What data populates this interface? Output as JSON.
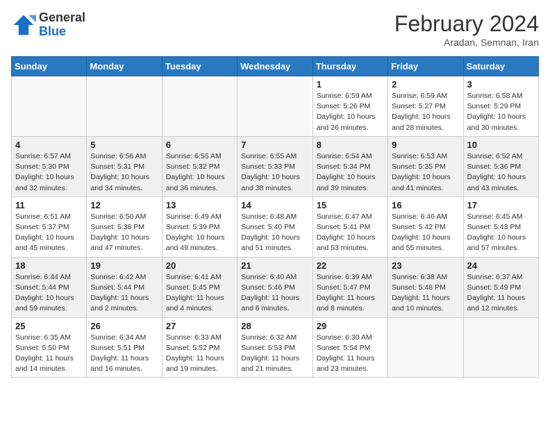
{
  "header": {
    "logo": {
      "general": "General",
      "blue": "Blue"
    },
    "title": "February 2024",
    "subtitle": "Aradan, Semnan, Iran"
  },
  "weekdays": [
    "Sunday",
    "Monday",
    "Tuesday",
    "Wednesday",
    "Thursday",
    "Friday",
    "Saturday"
  ],
  "weeks": [
    [
      {
        "day": "",
        "info": ""
      },
      {
        "day": "",
        "info": ""
      },
      {
        "day": "",
        "info": ""
      },
      {
        "day": "",
        "info": ""
      },
      {
        "day": "1",
        "info": "Sunrise: 6:59 AM\nSunset: 5:26 PM\nDaylight: 10 hours and 26 minutes."
      },
      {
        "day": "2",
        "info": "Sunrise: 6:59 AM\nSunset: 5:27 PM\nDaylight: 10 hours and 28 minutes."
      },
      {
        "day": "3",
        "info": "Sunrise: 6:58 AM\nSunset: 5:29 PM\nDaylight: 10 hours and 30 minutes."
      }
    ],
    [
      {
        "day": "4",
        "info": "Sunrise: 6:57 AM\nSunset: 5:30 PM\nDaylight: 10 hours and 32 minutes."
      },
      {
        "day": "5",
        "info": "Sunrise: 6:56 AM\nSunset: 5:31 PM\nDaylight: 10 hours and 34 minutes."
      },
      {
        "day": "6",
        "info": "Sunrise: 6:55 AM\nSunset: 5:32 PM\nDaylight: 10 hours and 36 minutes."
      },
      {
        "day": "7",
        "info": "Sunrise: 6:55 AM\nSunset: 5:33 PM\nDaylight: 10 hours and 38 minutes."
      },
      {
        "day": "8",
        "info": "Sunrise: 6:54 AM\nSunset: 5:34 PM\nDaylight: 10 hours and 39 minutes."
      },
      {
        "day": "9",
        "info": "Sunrise: 6:53 AM\nSunset: 5:35 PM\nDaylight: 10 hours and 41 minutes."
      },
      {
        "day": "10",
        "info": "Sunrise: 6:52 AM\nSunset: 5:36 PM\nDaylight: 10 hours and 43 minutes."
      }
    ],
    [
      {
        "day": "11",
        "info": "Sunrise: 6:51 AM\nSunset: 5:37 PM\nDaylight: 10 hours and 45 minutes."
      },
      {
        "day": "12",
        "info": "Sunrise: 6:50 AM\nSunset: 5:38 PM\nDaylight: 10 hours and 47 minutes."
      },
      {
        "day": "13",
        "info": "Sunrise: 6:49 AM\nSunset: 5:39 PM\nDaylight: 10 hours and 49 minutes."
      },
      {
        "day": "14",
        "info": "Sunrise: 6:48 AM\nSunset: 5:40 PM\nDaylight: 10 hours and 51 minutes."
      },
      {
        "day": "15",
        "info": "Sunrise: 6:47 AM\nSunset: 5:41 PM\nDaylight: 10 hours and 53 minutes."
      },
      {
        "day": "16",
        "info": "Sunrise: 6:46 AM\nSunset: 5:42 PM\nDaylight: 10 hours and 55 minutes."
      },
      {
        "day": "17",
        "info": "Sunrise: 6:45 AM\nSunset: 5:43 PM\nDaylight: 10 hours and 57 minutes."
      }
    ],
    [
      {
        "day": "18",
        "info": "Sunrise: 6:44 AM\nSunset: 5:44 PM\nDaylight: 10 hours and 59 minutes."
      },
      {
        "day": "19",
        "info": "Sunrise: 6:42 AM\nSunset: 5:44 PM\nDaylight: 11 hours and 2 minutes."
      },
      {
        "day": "20",
        "info": "Sunrise: 6:41 AM\nSunset: 5:45 PM\nDaylight: 11 hours and 4 minutes."
      },
      {
        "day": "21",
        "info": "Sunrise: 6:40 AM\nSunset: 5:46 PM\nDaylight: 11 hours and 6 minutes."
      },
      {
        "day": "22",
        "info": "Sunrise: 6:39 AM\nSunset: 5:47 PM\nDaylight: 11 hours and 8 minutes."
      },
      {
        "day": "23",
        "info": "Sunrise: 6:38 AM\nSunset: 5:48 PM\nDaylight: 11 hours and 10 minutes."
      },
      {
        "day": "24",
        "info": "Sunrise: 6:37 AM\nSunset: 5:49 PM\nDaylight: 11 hours and 12 minutes."
      }
    ],
    [
      {
        "day": "25",
        "info": "Sunrise: 6:35 AM\nSunset: 5:50 PM\nDaylight: 11 hours and 14 minutes."
      },
      {
        "day": "26",
        "info": "Sunrise: 6:34 AM\nSunset: 5:51 PM\nDaylight: 11 hours and 16 minutes."
      },
      {
        "day": "27",
        "info": "Sunrise: 6:33 AM\nSunset: 5:52 PM\nDaylight: 11 hours and 19 minutes."
      },
      {
        "day": "28",
        "info": "Sunrise: 6:32 AM\nSunset: 5:53 PM\nDaylight: 11 hours and 21 minutes."
      },
      {
        "day": "29",
        "info": "Sunrise: 6:30 AM\nSunset: 5:54 PM\nDaylight: 11 hours and 23 minutes."
      },
      {
        "day": "",
        "info": ""
      },
      {
        "day": "",
        "info": ""
      }
    ]
  ]
}
